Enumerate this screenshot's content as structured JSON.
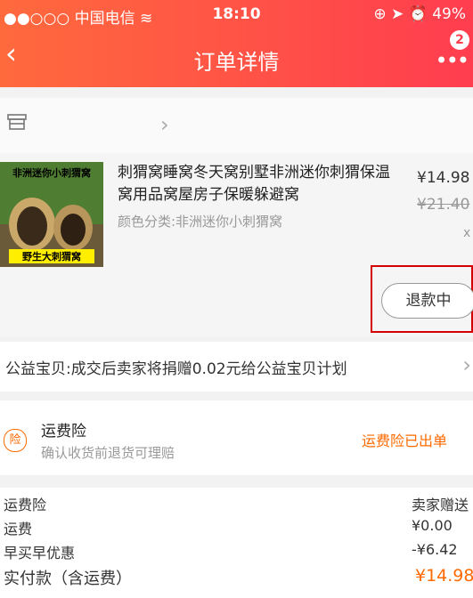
{
  "status_bar": {
    "carrier": "●●○○○ 中国电信 ≋",
    "time": "18:10",
    "right": "⊕ ➤ ⏰ 49%"
  },
  "header": {
    "title": "订单详情",
    "badge": "2",
    "back_icon": "chevron-left-icon",
    "more_icon": "more-icon"
  },
  "shop": {
    "icon": "store-icon"
  },
  "product": {
    "image_caption_top": "非洲迷你小刺猬窝",
    "image_caption_bottom": "野生大刺猬窝",
    "title": "刺猬窝睡窝冬天窝别墅非洲迷你刺猬保温窝用品窝屋房子保暖躲避窝",
    "spec": "颜色分类:非洲迷你小刺猬窝",
    "price": "¥14.98",
    "original_price": "¥21.40",
    "qty_prefix": "x",
    "refund_label": "退款中"
  },
  "charity": {
    "text": "公益宝贝:成交后卖家将捐赠0.02元给公益宝贝计划"
  },
  "insurance": {
    "icon_text": "险",
    "title": "运费险",
    "subtitle": "确认收货前退货可理赔",
    "status": "运费险已出单"
  },
  "summary": [
    {
      "label": "运费险",
      "value": "卖家赠送"
    },
    {
      "label": "运费",
      "value": "¥0.00"
    },
    {
      "label": "早买早优惠",
      "value": "-¥6.42"
    },
    {
      "label": "实付款（含运费）",
      "value": "¥14.98"
    }
  ],
  "colors": {
    "header_start": "#ff6a3d",
    "header_end": "#ff3d4f",
    "accent": "#ff6a00",
    "highlight": "#d40000"
  }
}
